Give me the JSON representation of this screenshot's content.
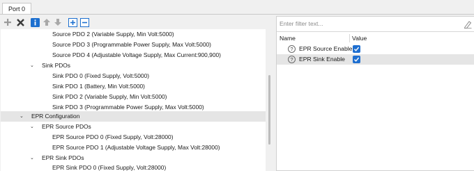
{
  "tab": {
    "label": "Port 0"
  },
  "toolbar": {
    "icons": [
      "add-icon",
      "remove-icon",
      "info-icon",
      "move-up-icon",
      "move-down-icon",
      "expand-all-icon",
      "collapse-all-icon"
    ]
  },
  "tree": {
    "rows": [
      {
        "text": "Source PDO 2 (Variable Supply, Min Volt:5000)",
        "chevron": ""
      },
      {
        "text": "Source PDO 3 (Programmable Power Supply, Max Volt:5000)",
        "chevron": ""
      },
      {
        "text": "Source PDO 4 (Adjustable Voltage Supply, Max Current:900,900)",
        "chevron": ""
      },
      {
        "text": "Sink PDOs",
        "chevron": "⌄"
      },
      {
        "text": "Sink PDO 0 (Fixed Supply, Volt:5000)",
        "chevron": ""
      },
      {
        "text": "Sink PDO 1 (Battery, Min Volt:5000)",
        "chevron": ""
      },
      {
        "text": "Sink PDO 2 (Variable Supply, Min Volt:5000)",
        "chevron": ""
      },
      {
        "text": "Sink PDO 3 (Programmable Power Supply, Max Volt:5000)",
        "chevron": ""
      },
      {
        "text": "EPR Configuration",
        "chevron": "⌄"
      },
      {
        "text": "EPR Source PDOs",
        "chevron": "⌄"
      },
      {
        "text": "EPR Source PDO 0 (Fixed Supply, Volt:28000)",
        "chevron": ""
      },
      {
        "text": "EPR Source PDO 1 (Adjustable Voltage Supply, Max Volt:28000)",
        "chevron": ""
      },
      {
        "text": "EPR Sink PDOs",
        "chevron": "⌄"
      },
      {
        "text": "EPR Sink PDO 0 (Fixed Supply, Volt:28000)",
        "chevron": ""
      }
    ]
  },
  "properties": {
    "filter_placeholder": "Enter filter text...",
    "col_name": "Name",
    "col_value": "Value",
    "rows": [
      {
        "name": "EPR Source Enable",
        "checked": true
      },
      {
        "name": "EPR Sink Enable",
        "checked": true
      }
    ],
    "help_glyph": "?"
  },
  "colors": {
    "accent": "#1f6fd0",
    "selection": "#e5e5e5",
    "toolbar_blue": "#1c6fcf"
  }
}
